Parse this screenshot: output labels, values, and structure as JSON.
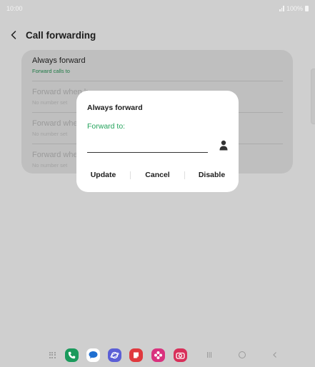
{
  "status_bar": {
    "time": "10:00",
    "battery": "100%"
  },
  "header": {
    "title": "Call forwarding"
  },
  "settings": {
    "rows": [
      {
        "title": "Always forward",
        "subtitle": "Forward calls to"
      },
      {
        "title": "Forward when b",
        "subtitle": "No number set"
      },
      {
        "title": "Forward whe",
        "subtitle": "No number set"
      },
      {
        "title": "Forward whe",
        "subtitle": "No number set"
      }
    ]
  },
  "dialog": {
    "title": "Always forward",
    "field_label": "Forward to:",
    "input_value": "",
    "buttons": {
      "update": "Update",
      "cancel": "Cancel",
      "disable": "Disable"
    }
  },
  "colors": {
    "accent_green": "#23a35b",
    "subtitle_green": "#1f7a46",
    "phone_app": "#1a9a5c",
    "messages_app": "#1f6fd1",
    "internet_app": "#5b5fd6",
    "notes_app": "#e0393e",
    "blossom_app": "#d9327e",
    "camera_app": "#d8305a"
  },
  "dock": {
    "apps": [
      "apps-grid-icon",
      "phone-icon",
      "messages-icon",
      "internet-icon",
      "notes-icon",
      "flower-icon",
      "camera-icon"
    ],
    "nav": [
      "recents-icon",
      "home-icon",
      "back-icon"
    ]
  }
}
